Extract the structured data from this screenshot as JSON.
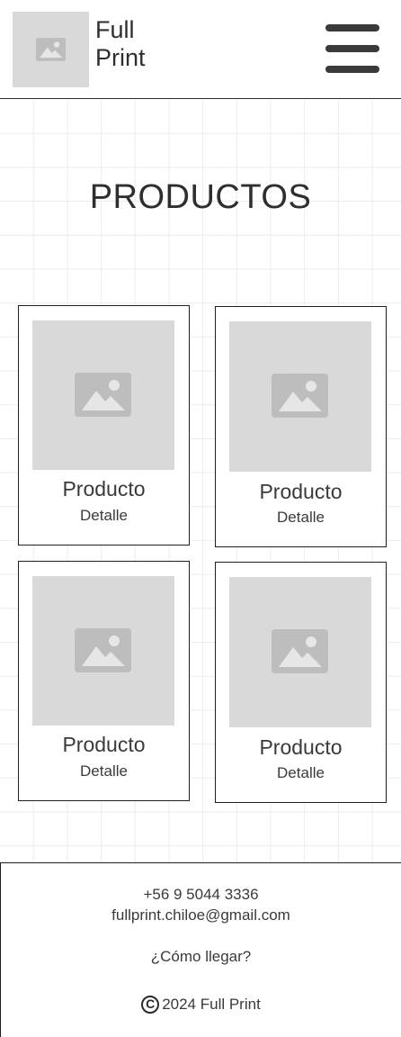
{
  "header": {
    "logo_icon": "image-placeholder-icon",
    "brand_line1": "Full",
    "brand_line2": "Print",
    "menu_icon": "hamburger-menu-icon"
  },
  "main": {
    "title": "PRODUCTOS",
    "products": [
      {
        "name": "Producto",
        "detail": "Detalle",
        "image_icon": "image-placeholder-icon"
      },
      {
        "name": "Producto",
        "detail": "Detalle",
        "image_icon": "image-placeholder-icon"
      },
      {
        "name": "Producto",
        "detail": "Detalle",
        "image_icon": "image-placeholder-icon"
      },
      {
        "name": "Producto",
        "detail": "Detalle",
        "image_icon": "image-placeholder-icon"
      }
    ]
  },
  "footer": {
    "phone": "+56 9 5044 3336",
    "email": "fullprint.chiloe@gmail.com",
    "directions": "¿Cómo llegar?",
    "copyright_symbol": "C",
    "copyright_text": "2024 Full Print"
  },
  "colors": {
    "placeholder_gray": "#d9d9d9",
    "placeholder_icon": "#bdbdbd",
    "text": "#3a3a3a",
    "border": "#1f1f1f",
    "grid_line": "#ececec"
  }
}
